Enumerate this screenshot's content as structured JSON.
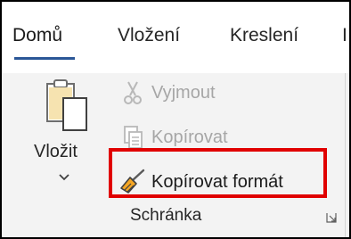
{
  "tabs": [
    {
      "label": "Domů",
      "active": true
    },
    {
      "label": "Vložení",
      "active": false
    },
    {
      "label": "Kreslení",
      "active": false
    },
    {
      "label": "I",
      "active": false
    }
  ],
  "clipboard_group": {
    "paste": {
      "label": "Vložit",
      "icon": "paste-clipboard-icon"
    },
    "cut": {
      "label": "Vyjmout",
      "icon": "scissors-icon",
      "enabled": false
    },
    "copy": {
      "label": "Kopírovat",
      "icon": "copy-icon",
      "enabled": false
    },
    "format_painter": {
      "label": "Kopírovat formát",
      "icon": "format-painter-icon",
      "enabled": true,
      "highlighted": true
    },
    "group_label": "Schránka",
    "launcher_icon": "dialog-launcher-icon"
  },
  "colors": {
    "highlight": "#e00000",
    "tab_underline": "#2b5797",
    "ribbon_bg": "#f3f3f3",
    "disabled_text": "#a6a6a6",
    "brush_accent": "#f5a623"
  }
}
